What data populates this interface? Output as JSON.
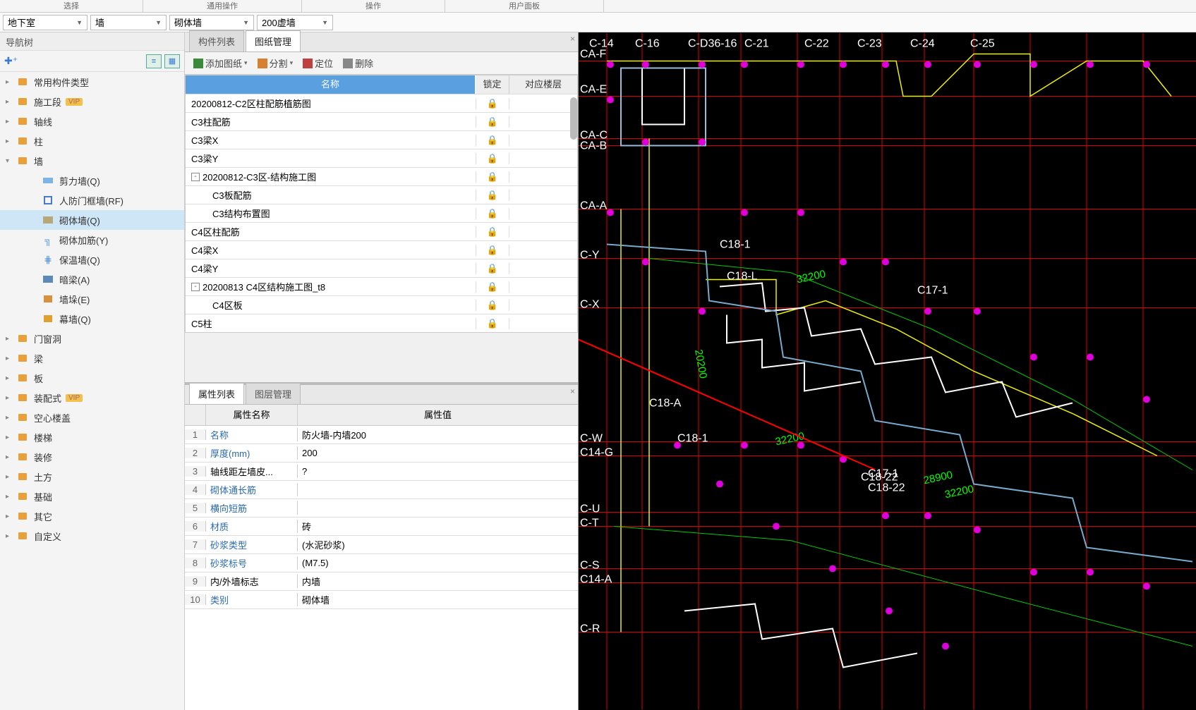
{
  "ribbon": {
    "t1": "选择",
    "t2": "通用操作",
    "t3": "操作",
    "t4": "用户面板"
  },
  "dropdowns": {
    "floor": "地下室",
    "cat": "墙",
    "type": "砌体墙",
    "sub": "200虚墙"
  },
  "nav": {
    "title": "导航树",
    "items": [
      {
        "label": "常用构件类型",
        "kind": "folder"
      },
      {
        "label": "施工段",
        "kind": "folder",
        "vip": true
      },
      {
        "label": "轴线",
        "kind": "folder"
      },
      {
        "label": "柱",
        "kind": "folder"
      },
      {
        "label": "墙",
        "kind": "folder",
        "expanded": true
      }
    ],
    "wall_children": [
      {
        "label": "剪力墙(Q)",
        "ic": "wall"
      },
      {
        "label": "人防门框墙(RF)",
        "ic": "rf"
      },
      {
        "label": "砌体墙(Q)",
        "ic": "brick",
        "selected": true
      },
      {
        "label": "砌体加筋(Y)",
        "ic": "y"
      },
      {
        "label": "保温墙(Q)",
        "ic": "grid"
      },
      {
        "label": "暗梁(A)",
        "ic": "dark"
      },
      {
        "label": "墙垛(E)",
        "ic": "block"
      },
      {
        "label": "幕墙(Q)",
        "ic": "curtain"
      }
    ],
    "items2": [
      {
        "label": "门窗洞"
      },
      {
        "label": "梁"
      },
      {
        "label": "板"
      },
      {
        "label": "装配式",
        "vip": true
      },
      {
        "label": "空心楼盖"
      },
      {
        "label": "楼梯"
      },
      {
        "label": "装修"
      },
      {
        "label": "土方"
      },
      {
        "label": "基础"
      },
      {
        "label": "其它"
      },
      {
        "label": "自定义"
      }
    ]
  },
  "drawings": {
    "tabs": {
      "list": "构件列表",
      "manage": "图纸管理"
    },
    "toolbar": {
      "add": "添加图纸",
      "split": "分割",
      "locate": "定位",
      "delete": "删除"
    },
    "columns": {
      "name": "名称",
      "lock": "锁定",
      "floor": "对应楼层"
    },
    "rows": [
      {
        "name": "20200812-C2区柱配筋植筋图",
        "lock": true
      },
      {
        "name": "C3柱配筋",
        "lock": true
      },
      {
        "name": "C3梁X",
        "lock": true
      },
      {
        "name": "C3梁Y",
        "lock": true
      },
      {
        "name": "20200812-C3区-结构施工图",
        "lock": true,
        "exp": "-"
      },
      {
        "name": "C3板配筋",
        "lock": true,
        "indent": true
      },
      {
        "name": "C3结构布置图",
        "lock": true,
        "indent": true
      },
      {
        "name": "C4区柱配筋",
        "lock": true
      },
      {
        "name": "C4梁X",
        "lock": true
      },
      {
        "name": "C4梁Y",
        "lock": true
      },
      {
        "name": "20200813 C4区结构施工图_t8",
        "lock": true,
        "exp": "-"
      },
      {
        "name": "C4区板",
        "lock": true,
        "indent": true
      },
      {
        "name": "C5柱",
        "lock": true
      }
    ]
  },
  "props": {
    "tabs": {
      "list": "属性列表",
      "layer": "图层管理"
    },
    "columns": {
      "name": "属性名称",
      "value": "属性值"
    },
    "rows": [
      {
        "idx": 1,
        "name": "名称",
        "value": "防火墙-内墙200",
        "blue": true
      },
      {
        "idx": 2,
        "name": "厚度(mm)",
        "value": "200",
        "blue": true
      },
      {
        "idx": 3,
        "name": "轴线距左墙皮...",
        "value": "?",
        "blue": false
      },
      {
        "idx": 4,
        "name": "砌体通长筋",
        "value": "",
        "blue": true
      },
      {
        "idx": 5,
        "name": "横向短筋",
        "value": "",
        "blue": true
      },
      {
        "idx": 6,
        "name": "材质",
        "value": "砖",
        "blue": true
      },
      {
        "idx": 7,
        "name": "砂浆类型",
        "value": "(水泥砂浆)",
        "blue": true
      },
      {
        "idx": 8,
        "name": "砂浆标号",
        "value": "(M7.5)",
        "blue": true
      },
      {
        "idx": 9,
        "name": "内/外墙标志",
        "value": "内墙",
        "blue": false
      },
      {
        "idx": 10,
        "name": "类别",
        "value": "砌体墙",
        "blue": true
      }
    ]
  },
  "cad": {
    "top_labels": [
      "C-14",
      "C-16",
      "C-D36-16",
      "C-21",
      "C-22",
      "C-23",
      "C-24",
      "C-25"
    ],
    "side_labels": [
      "CA-F",
      "CA-E",
      "CA-C",
      "CA-B",
      "CA-A",
      "C-Y",
      "C-X",
      "C-W",
      "C14-G",
      "C-U",
      "C-T",
      "C-S",
      "C14-A",
      "C-R"
    ],
    "mid_labels": [
      "C18-1",
      "C18-L",
      "C18-A",
      "C18-1",
      "C17-1",
      "C18-22",
      "C17-1",
      "C18-22"
    ],
    "dims": [
      "32200",
      "20200",
      "32200",
      "28900",
      "32200"
    ]
  }
}
